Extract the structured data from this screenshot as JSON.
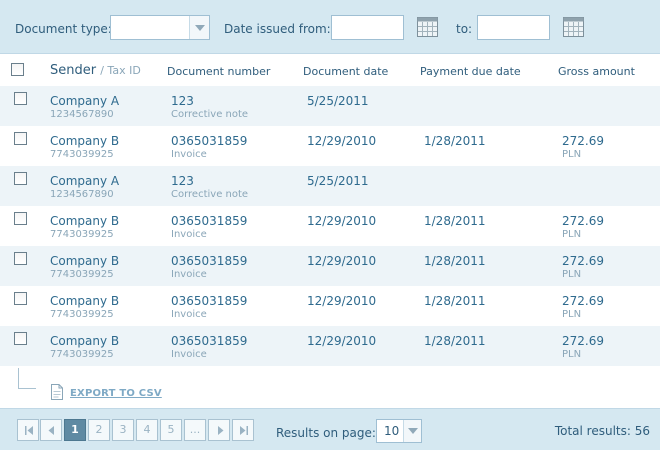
{
  "filters": {
    "document_type_label": "Document type:",
    "document_type_value": "",
    "date_from_label": "Date issued from:",
    "date_from_value": "",
    "date_to_label": "to:",
    "date_to_value": ""
  },
  "table": {
    "headers": {
      "sender": "Sender",
      "tax_id": "/ Tax ID",
      "document_number": "Document number",
      "document_date": "Document date",
      "payment_due_date": "Payment due date",
      "gross_amount": "Gross amount"
    },
    "rows": [
      {
        "sender": "Company A",
        "tax_id": "1234567890",
        "doc_number": "123",
        "doc_type": "Corrective note",
        "doc_date": "5/25/2011",
        "due_date": "",
        "amount": "",
        "currency": ""
      },
      {
        "sender": "Company B",
        "tax_id": "7743039925",
        "doc_number": "0365031859",
        "doc_type": "Invoice",
        "doc_date": "12/29/2010",
        "due_date": "1/28/2011",
        "amount": "272.69",
        "currency": "PLN"
      },
      {
        "sender": "Company A",
        "tax_id": "1234567890",
        "doc_number": "123",
        "doc_type": "Corrective note",
        "doc_date": "5/25/2011",
        "due_date": "",
        "amount": "",
        "currency": ""
      },
      {
        "sender": "Company B",
        "tax_id": "7743039925",
        "doc_number": "0365031859",
        "doc_type": "Invoice",
        "doc_date": "12/29/2010",
        "due_date": "1/28/2011",
        "amount": "272.69",
        "currency": "PLN"
      },
      {
        "sender": "Company B",
        "tax_id": "7743039925",
        "doc_number": "0365031859",
        "doc_type": "Invoice",
        "doc_date": "12/29/2010",
        "due_date": "1/28/2011",
        "amount": "272.69",
        "currency": "PLN"
      },
      {
        "sender": "Company B",
        "tax_id": "7743039925",
        "doc_number": "0365031859",
        "doc_type": "Invoice",
        "doc_date": "12/29/2010",
        "due_date": "1/28/2011",
        "amount": "272.69",
        "currency": "PLN"
      },
      {
        "sender": "Company B",
        "tax_id": "7743039925",
        "doc_number": "0365031859",
        "doc_type": "Invoice",
        "doc_date": "12/29/2010",
        "due_date": "1/28/2011",
        "amount": "272.69",
        "currency": "PLN"
      }
    ]
  },
  "export": {
    "label": "EXPORT TO CSV",
    "icon": "document-icon"
  },
  "pagination": {
    "pages": [
      "1",
      "2",
      "3",
      "4",
      "5",
      "..."
    ],
    "current_page": "1",
    "results_on_page_label": "Results on page:",
    "results_on_page_value": "10",
    "total_results": "Total results: 56"
  },
  "colors": {
    "bar_background": "#d5e8f1",
    "row_alt": "#edf4f8",
    "text": "#2e6a8e",
    "active_page": "#5f8aa3"
  }
}
